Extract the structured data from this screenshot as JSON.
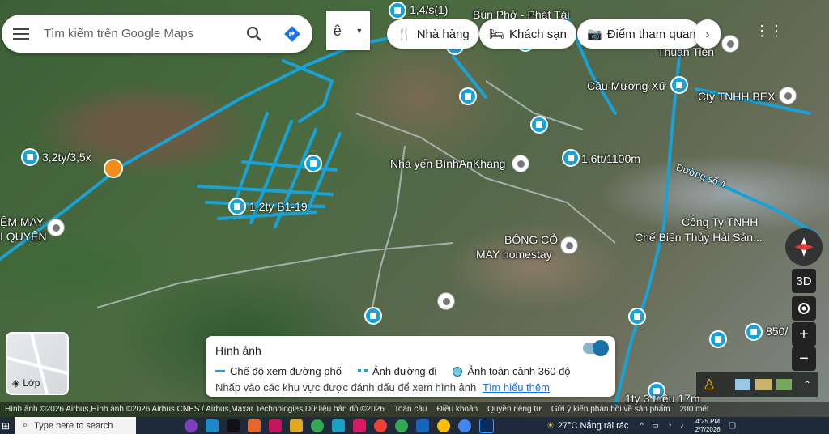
{
  "search": {
    "placeholder": "Tìm kiếm trên Google Maps"
  },
  "lang_button": "ê",
  "chips": [
    {
      "label": "Nhà hàng",
      "icon": "fork-knife-icon"
    },
    {
      "label": "Khách sạn",
      "icon": "bed-icon"
    },
    {
      "label": "Điểm tham quan",
      "icon": "camera-icon"
    }
  ],
  "map_labels": {
    "l1": "1,4/s(1)",
    "l2": "Bún Phở - Phát Tài",
    "l3": "Thuận Tiến",
    "l4": "Cầu Mương Xứ",
    "l5": "Cty TNHH BEX",
    "l6": "3,2ty/3,5x",
    "l7": "Nhà yến BìnhAnKhang",
    "l8": "1,6tt/1100m",
    "l9": "Đường số 4",
    "l10": "1,2ty B1-19",
    "l11": "ỆM MAY",
    "l12": "I QUYÊN",
    "l13": "Công Ty TNHH",
    "l14": "Chế Biến Thủy Hải Sản...",
    "l15": "BÔNG CỎ",
    "l16": "MAY homestay",
    "l17": "850/",
    "l18": "1ty 3 triệu 17m"
  },
  "panel": {
    "title": "Hình ảnh",
    "legend_street": "Chế độ xem đường phố",
    "legend_photo": "Ảnh đường đi",
    "legend_360": "Ảnh toàn cảnh 360 độ",
    "hint": "Nhấp vào các khu vực được đánh dấu để xem hình ảnh",
    "learn_more": "Tìm hiểu thêm"
  },
  "layer_label": "Lớp",
  "controls": {
    "three_d": "3D",
    "zoom_in": "+",
    "zoom_out": "−"
  },
  "attribution": {
    "imagery": "Hình ảnh ©2026 Airbus,Hình ảnh ©2026 Airbus,CNES / Airbus,Maxar Technologies,Dữ liệu bản đồ ©2026",
    "global": "Toàn cầu",
    "terms": "Điều khoản",
    "privacy": "Quyền riêng tư",
    "feedback": "Gửi ý kiến phản hồi về sản phẩm",
    "scale": "200 mét"
  },
  "taskbar": {
    "search_placeholder": "Type here to search",
    "weather": "27°C  Nắng rải rác",
    "time": "4:25 PM",
    "date": "2/7/2026"
  },
  "colors": {
    "route": "#1aa1d6",
    "pin": "#1aa1d6"
  }
}
